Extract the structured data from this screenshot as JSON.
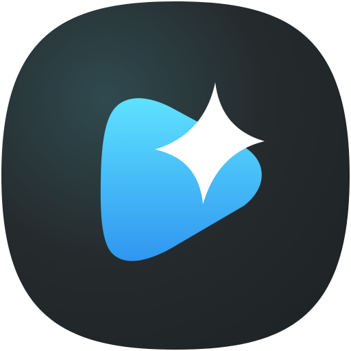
{
  "app_icon": {
    "name": "video-play-sparkle-app-icon",
    "icon_parts": [
      "squircle-background",
      "play-triangle-icon",
      "sparkle-star-icon"
    ]
  },
  "colors": {
    "background_glow": "#2f4a4f",
    "background_base": "#252a2c",
    "background_edge": "#1f2426",
    "play_top": "#5ee2ff",
    "play_bottom": "#2f96f0",
    "sparkle": "#ffffff"
  }
}
